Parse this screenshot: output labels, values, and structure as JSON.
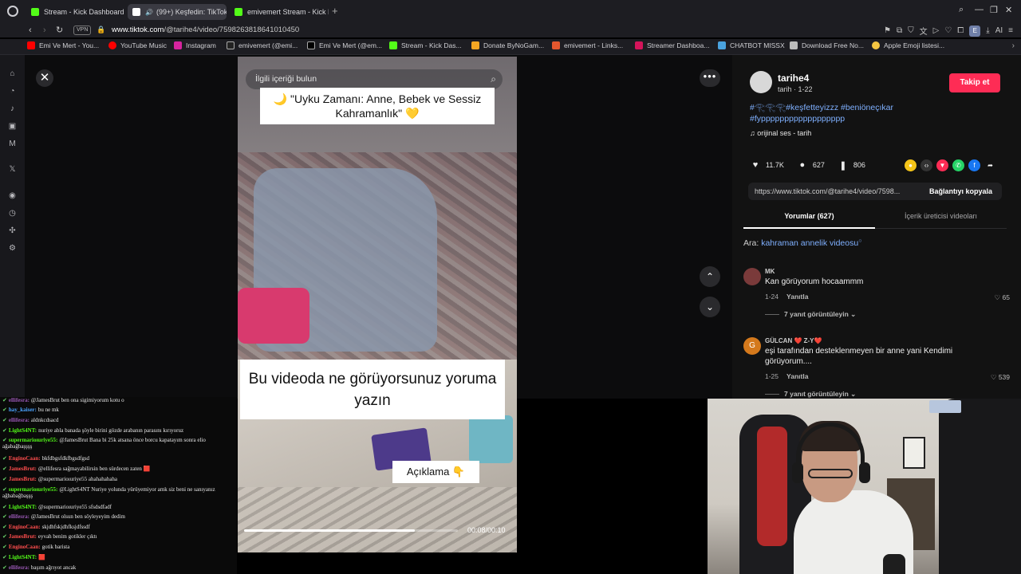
{
  "browser": {
    "tabs": [
      {
        "label": "Stream - Kick Dashboard",
        "color": "#53fc18"
      },
      {
        "label": "(99+) Keşfedin: TikTok",
        "color": "#ffffff",
        "active": true
      },
      {
        "label": "emivemert Stream - Kick D",
        "color": "#53fc18"
      }
    ],
    "url_host": "www.tiktok.com",
    "url_path": "/@tarihe4/video/7598263818641010450",
    "vpn_label": "VPN",
    "profile_initial": "E",
    "ai_label": "AI",
    "bookmarks": [
      {
        "label": "Emi Ve Mert - You...",
        "color": "#ff0000"
      },
      {
        "label": "YouTube Music",
        "color": "#ff0000"
      },
      {
        "label": "Instagram",
        "color": "#d6249f"
      },
      {
        "label": "emivemert (@emi...",
        "color": "#ffffff"
      },
      {
        "label": "Emi Ve Mert (@em...",
        "color": "#ffffff"
      },
      {
        "label": "Stream - Kick Das...",
        "color": "#53fc18"
      },
      {
        "label": "Donate ByNoGam...",
        "color": "#f5a623"
      },
      {
        "label": "emivemert - Links...",
        "color": "#e4572e"
      },
      {
        "label": "Streamer Dashboa...",
        "color": "#d4145a"
      },
      {
        "label": "CHATBOT MISSX",
        "color": "#4aa3df"
      },
      {
        "label": "Download Free No...",
        "color": "#bbbbbb"
      },
      {
        "label": "Apple Emoji listesi...",
        "color": "#f5c542"
      }
    ]
  },
  "video": {
    "search_placeholder": "İlgili içeriği bulun",
    "caption_top": "🌙 \"Uyku Zamanı: Anne, Bebek ve Sessiz Kahramanlık\" 💛",
    "caption_mid": "Bu videoda ne görüyorsunuz yoruma yazın",
    "caption_low": "Açıklama 👇",
    "time": "00:08/00:10",
    "progress": 0.8
  },
  "creator": {
    "username": "tarihe4",
    "sub": "tarih · 1-22",
    "follow_label": "Takip et",
    "hashtags": "#𓂀𓂀𓂀#keşfetteyizzz #beniöneçıkar #fypppppppppppppppppp",
    "sound": "♫ orijinal ses - tarih"
  },
  "stats": {
    "likes": "11.7K",
    "comments": "627",
    "saves": "806"
  },
  "share": {
    "link": "https://www.tiktok.com/@tarihe4/video/7598...",
    "copy_label": "Bağlantıyı kopyala"
  },
  "tabs": {
    "comments": "Yorumlar (627)",
    "creator_videos": "İçerik üreticisi videoları"
  },
  "search_hint": {
    "prefix": "Ara:",
    "query": "kahraman annelik videosu"
  },
  "comments": [
    {
      "name": "MK",
      "text": "Kan görüyorum hocaammm",
      "date": "1-24",
      "reply": "Yanıtla",
      "likes": "65",
      "more": "7 yanıt görüntüleyin",
      "avatar": "#7a3a3a"
    },
    {
      "name": "GÜLCAN ❤️ Z-Y❤️",
      "text": "eşi tarafından desteklenmeyen bir anne yani Kendimi görüyorum....",
      "date": "1-25",
      "reply": "Yanıtla",
      "likes": "539",
      "more": "7 yanıt görüntüleyin",
      "avatar": "#d4791c",
      "initial": "G"
    }
  ],
  "chat": [
    {
      "user": "ellifesra:",
      "color": "#9b59b6",
      "msg": "@JamesBrut ben ona sigimiyorum kotu o"
    },
    {
      "user": "hay_kaiser:",
      "color": "#4aa3ff",
      "msg": "bu ne mk"
    },
    {
      "user": "ellifesra:",
      "color": "#9b59b6",
      "msg": "aldnkcdsacd"
    },
    {
      "user": "LightS4NT:",
      "color": "#53fc18",
      "msg": "nuriye abla banada şöyle birini gözde arabanın parasını kırıyoruz"
    },
    {
      "user": "supermarioıuriye55:",
      "color": "#53fc18",
      "msg": "@JamesBrut Bana bi 25k atsana önce borcu kapatayım sonra elio ağabağbaşşşş"
    },
    {
      "user": "EnginoCaan:",
      "color": "#ff4d4d",
      "msg": "bkfdbgsfdkfbgsdfgsd"
    },
    {
      "user": "JamesBrut:",
      "color": "#ff4d4d",
      "msg": "@ellifesra sağmayabilirsin ben sürdecen zaten 🟥"
    },
    {
      "user": "JamesBrut:",
      "color": "#ff4d4d",
      "msg": "@supermarioıuriye55 ahahahahaha"
    },
    {
      "user": "supermarioıuriye55:",
      "color": "#53fc18",
      "msg": "@LightS4NT Nuriye yolunda yürüyemiyor amk siz beni ne sanıyanız ağbabağbaşşş"
    },
    {
      "user": "LightS4NT:",
      "color": "#53fc18",
      "msg": "@supermarioıuriye55 sfsdsdfadf"
    },
    {
      "user": "ellifesra:",
      "color": "#9b59b6",
      "msg": "@JamesBrut olsun ben söyleyeyim dedim"
    },
    {
      "user": "EnginoCaan:",
      "color": "#ff4d4d",
      "msg": "skjdhfskjdhfksjdfssdf"
    },
    {
      "user": "JamesBrut:",
      "color": "#ff4d4d",
      "msg": "eyvah benim gotikler çıktı"
    },
    {
      "user": "EnginoCaan:",
      "color": "#ff4d4d",
      "msg": "gotik barista"
    },
    {
      "user": "LightS4NT:",
      "color": "#53fc18",
      "msg": "🟥"
    },
    {
      "user": "ellifesra:",
      "color": "#9b59b6",
      "msg": "başım ağrıyot ancak"
    }
  ]
}
